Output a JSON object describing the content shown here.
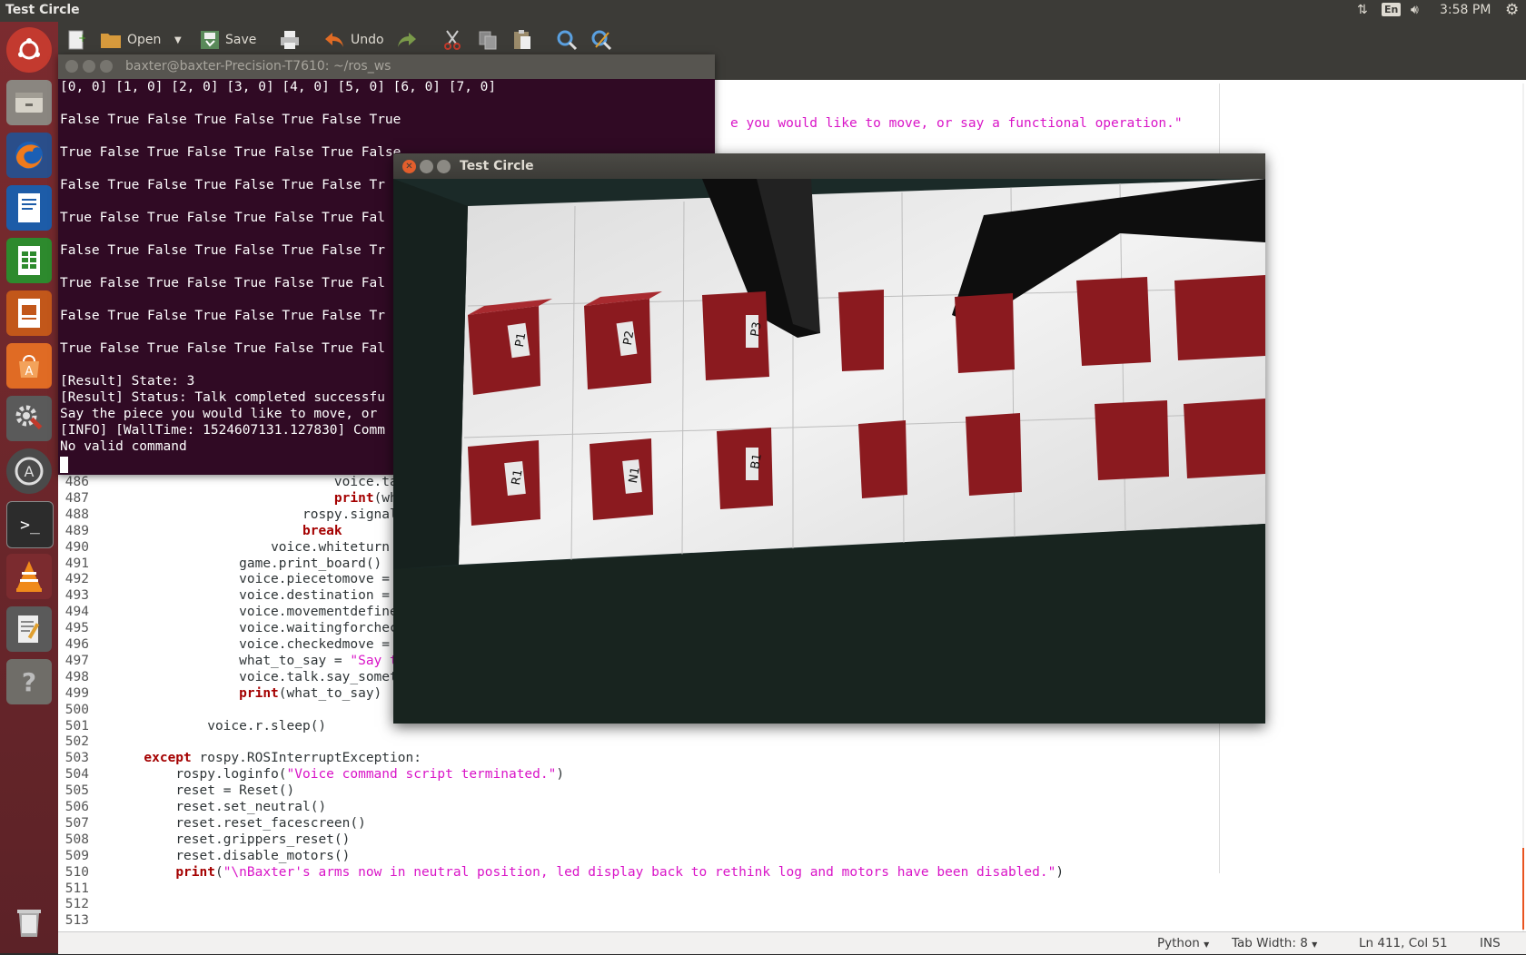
{
  "top_panel": {
    "app_title": "Test Circle",
    "lang": "En",
    "time": "3:58 PM"
  },
  "launcher": {
    "items": [
      "ubuntu-dash",
      "files",
      "firefox",
      "writer",
      "calc",
      "impress",
      "software-center",
      "system-settings",
      "software-updater",
      "terminal",
      "vlc",
      "text-editor",
      "help",
      "trash"
    ]
  },
  "gedit": {
    "toolbar": {
      "open_label": "Open",
      "save_label": "Save",
      "undo_label": "Undo"
    },
    "top_code_fragment": "e you would like to move, or say a functional operation.\"",
    "code_lines": [
      {
        "n": "486",
        "indent": "                              ",
        "segs": [
          [
            "",
            "voice.tal"
          ]
        ]
      },
      {
        "n": "487",
        "indent": "                              ",
        "segs": [
          [
            "kw",
            "print"
          ],
          [
            "",
            "(wha"
          ]
        ]
      },
      {
        "n": "488",
        "indent": "                          ",
        "segs": [
          [
            "",
            "rospy.signal_"
          ]
        ]
      },
      {
        "n": "489",
        "indent": "                          ",
        "segs": [
          [
            "kw",
            "break"
          ]
        ]
      },
      {
        "n": "490",
        "indent": "                      ",
        "segs": [
          [
            "",
            "voice.whiteturn ="
          ]
        ]
      },
      {
        "n": "491",
        "indent": "                  ",
        "segs": [
          [
            "",
            "game.print_board()"
          ]
        ]
      },
      {
        "n": "492",
        "indent": "                  ",
        "segs": [
          [
            "",
            "voice.piecetomove = "
          ],
          [
            "str",
            "'"
          ]
        ]
      },
      {
        "n": "493",
        "indent": "                  ",
        "segs": [
          [
            "",
            "voice.destination = "
          ],
          [
            "str",
            "'"
          ]
        ]
      },
      {
        "n": "494",
        "indent": "                  ",
        "segs": [
          [
            "",
            "voice.movementdefined"
          ]
        ]
      },
      {
        "n": "495",
        "indent": "                  ",
        "segs": [
          [
            "",
            "voice.waitingforcheck"
          ]
        ]
      },
      {
        "n": "496",
        "indent": "                  ",
        "segs": [
          [
            "",
            "voice.checkedmove = "
          ],
          [
            "str",
            "F"
          ]
        ]
      },
      {
        "n": "497",
        "indent": "                  ",
        "segs": [
          [
            "",
            "what_to_say = "
          ],
          [
            "str",
            "\"Say th"
          ]
        ]
      },
      {
        "n": "498",
        "indent": "                  ",
        "segs": [
          [
            "",
            "voice.talk.say_someth"
          ]
        ]
      },
      {
        "n": "499",
        "indent": "                  ",
        "segs": [
          [
            "kw",
            "print"
          ],
          [
            "",
            "(what_to_say)"
          ]
        ]
      },
      {
        "n": "500",
        "indent": "",
        "segs": []
      },
      {
        "n": "501",
        "indent": "              ",
        "segs": [
          [
            "",
            "voice.r.sleep()"
          ]
        ]
      },
      {
        "n": "502",
        "indent": "",
        "segs": []
      },
      {
        "n": "503",
        "indent": "      ",
        "segs": [
          [
            "kw",
            "except"
          ],
          [
            "",
            " rospy.ROSInterruptException:"
          ]
        ]
      },
      {
        "n": "504",
        "indent": "          ",
        "segs": [
          [
            "",
            "rospy.loginfo("
          ],
          [
            "str",
            "\"Voice command script terminated.\""
          ],
          [
            "",
            ")"
          ]
        ]
      },
      {
        "n": "505",
        "indent": "          ",
        "segs": [
          [
            "",
            "reset = Reset()"
          ]
        ]
      },
      {
        "n": "506",
        "indent": "          ",
        "segs": [
          [
            "",
            "reset.set_neutral()"
          ]
        ]
      },
      {
        "n": "507",
        "indent": "          ",
        "segs": [
          [
            "",
            "reset.reset_facescreen()"
          ]
        ]
      },
      {
        "n": "508",
        "indent": "          ",
        "segs": [
          [
            "",
            "reset.grippers_reset()"
          ]
        ]
      },
      {
        "n": "509",
        "indent": "          ",
        "segs": [
          [
            "",
            "reset.disable_motors()"
          ]
        ]
      },
      {
        "n": "510",
        "indent": "          ",
        "segs": [
          [
            "kw",
            "print"
          ],
          [
            "",
            "("
          ],
          [
            "str",
            "\"\\nBaxter's arms now in neutral position, led display back to rethink log and motors have been disabled.\""
          ],
          [
            "",
            ")"
          ]
        ]
      },
      {
        "n": "511",
        "indent": "",
        "segs": []
      },
      {
        "n": "512",
        "indent": "",
        "segs": []
      },
      {
        "n": "513",
        "indent": "",
        "segs": []
      }
    ],
    "status": {
      "language": "Python",
      "tab_width": "Tab Width: 8",
      "position": "Ln 411, Col 51",
      "mode": "INS"
    }
  },
  "terminal": {
    "title": "baxter@baxter-Precision-T7610: ~/ros_ws",
    "lines": [
      "[0, 0] [1, 0] [2, 0] [3, 0] [4, 0] [5, 0] [6, 0] [7, 0]",
      "",
      "False True False True False True False True",
      "",
      "True False True False True False True False",
      "",
      "False True False True False True False Tr",
      "",
      "True False True False True False True Fal",
      "",
      "False True False True False True False Tr",
      "",
      "True False True False True False True Fal",
      "",
      "False True False True False True False Tr",
      "",
      "True False True False True False True Fal",
      "",
      "[Result] State: 3",
      "[Result] Status: Talk completed successfu",
      "Say the piece you would like to move, or",
      "[INFO] [WallTime: 1524607131.127830] Comm",
      "No valid command"
    ]
  },
  "camera_window": {
    "title": "Test Circle",
    "piece_labels": [
      "P1",
      "P2",
      "P3",
      "R1",
      "N1",
      "B1"
    ]
  }
}
